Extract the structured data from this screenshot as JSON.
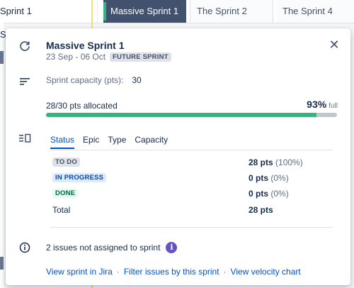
{
  "background": {
    "sprint_tabs": [
      "Sprint 1",
      "Massive Sprint 1",
      "The Sprint 2",
      "The Sprint 4"
    ],
    "left_label": "S"
  },
  "popup": {
    "title": "Massive Sprint 1",
    "dates": "23 Sep - 06 Oct",
    "status_lozenge": "FUTURE SPRINT",
    "capacity_label": "Sprint capacity (pts):",
    "capacity_value": "30",
    "allocated_label": "28/30 pts allocated",
    "allocated_percent_value": 0.93,
    "allocated_percent": "93%",
    "allocated_suffix": "full",
    "tabs": [
      {
        "label": "Status",
        "active": true
      },
      {
        "label": "Epic",
        "active": false
      },
      {
        "label": "Type",
        "active": false
      },
      {
        "label": "Capacity",
        "active": false
      }
    ],
    "status_rows": [
      {
        "label": "TO DO",
        "points": "28 pts",
        "percent": "(100%)"
      },
      {
        "label": "IN PROGRESS",
        "points": "0 pts",
        "percent": "(0%)"
      },
      {
        "label": "DONE",
        "points": "0 pts",
        "percent": "(0%)"
      }
    ],
    "total": {
      "label": "Total",
      "points": "28 pts"
    },
    "issues_text": "2 issues not assigned to sprint",
    "issues_badge": "i",
    "links": [
      "View sprint in Jira",
      "Filter issues by this sprint",
      "View velocity chart"
    ],
    "link_separator": "·"
  },
  "colors": {
    "progress_fill": "#36b37e",
    "link": "#0052cc",
    "badge": "#6554c0"
  }
}
